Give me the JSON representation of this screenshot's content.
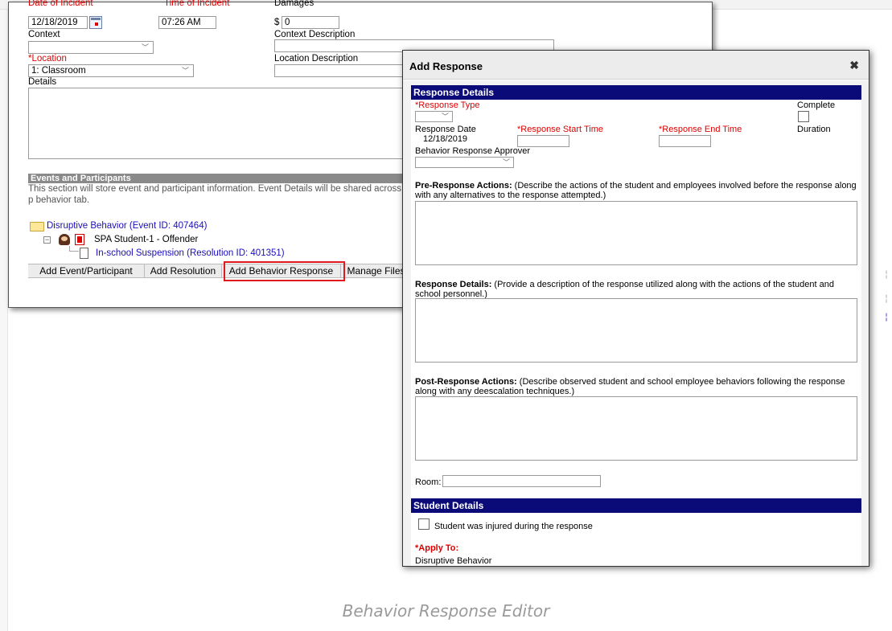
{
  "incident": {
    "date_label": "Date of Incident",
    "date_value": "12/18/2019",
    "time_label": "Time of Incident",
    "time_value": "07:26 AM",
    "damages_label": "Damages",
    "damages_currency": "$",
    "damages_value": "0",
    "context_label": "Context",
    "context_value": "",
    "context_description_label": "Context Description",
    "location_label": "*Location",
    "location_value": "1: Classroom",
    "location_description_label": "Location Description",
    "details_label": "Details"
  },
  "events": {
    "header": "Events and Participants",
    "description": "This section will store event and participant information. Event Details will be shared across p behavior tab.",
    "event_link": "Disruptive Behavior (Event ID: 407464)",
    "participant": "SPA Student-1 - Offender",
    "resolution_link": "In-school Suspension (Resolution ID: 401351)",
    "buttons": {
      "add_event": "Add Event/Participant",
      "add_resolution": "Add Resolution",
      "add_behavior_response": "Add Behavior Response",
      "manage_files": "Manage Files"
    }
  },
  "modal": {
    "title": "Add Response",
    "close_glyph": "✖",
    "response_details_header": "Response Details",
    "response_type_label": "*Response Type",
    "complete_label": "Complete",
    "response_date_label": "Response Date",
    "response_date_value": "12/18/2019",
    "start_time_label": "*Response Start Time",
    "end_time_label": "*Response End Time",
    "duration_label": "Duration",
    "approver_label": "Behavior Response Approver",
    "pre_actions_label": "Pre-Response Actions:",
    "pre_actions_desc": " (Describe the actions of the student and employees involved before the response along with any alternatives to the response attempted.)",
    "response_details_label": "Response Details:",
    "response_details_desc": " (Provide a description of the response utilized along with the actions of the student and school personnel.)",
    "post_actions_label": "Post-Response Actions:",
    "post_actions_desc": " (Describe observed student and school employee behaviors following the response along with any deescalation techniques.)",
    "room_label": "Room:",
    "student_details_header": "Student Details",
    "injured_label": "Student was injured during the response",
    "apply_to_label": "*Apply To:",
    "apply_to_value": "Disruptive Behavior"
  },
  "caption": "Behavior Response Editor",
  "colors": {
    "modal_header_bar": "#0a0a78",
    "required_text": "#e00000",
    "link_text": "#1a0dbb",
    "highlight_border": "#e0191f"
  }
}
